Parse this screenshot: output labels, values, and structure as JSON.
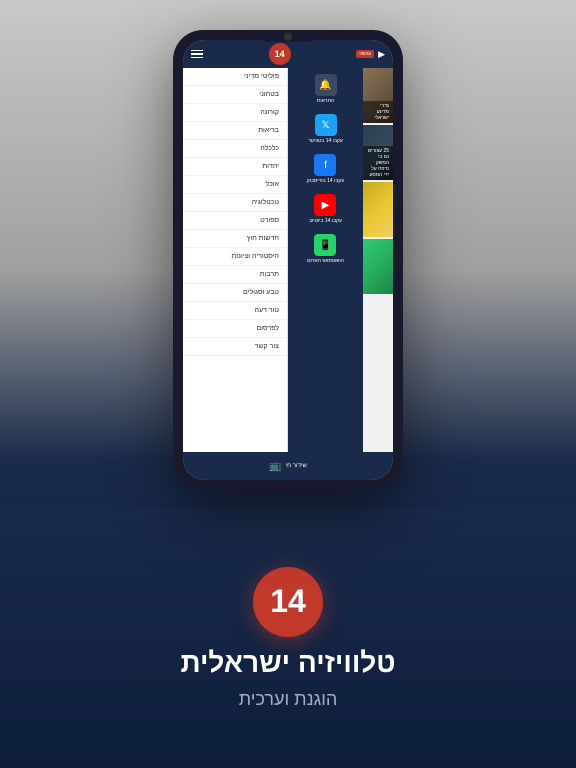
{
  "background": {
    "top_color": "#c8c8c8",
    "bottom_color": "#0d1e3a"
  },
  "phone": {
    "header": {
      "logo": "14",
      "live_label": "עכשיו"
    },
    "sidebar": {
      "items": [
        {
          "label": "פוליטי מדיני"
        },
        {
          "label": "בטחוני"
        },
        {
          "label": "קורונה"
        },
        {
          "label": "בריאות"
        },
        {
          "label": "כלכלה"
        },
        {
          "label": "יהדות"
        },
        {
          "label": "אוכל"
        },
        {
          "label": "טכנולוגיה"
        },
        {
          "label": "ספורט"
        },
        {
          "label": "חדשות חוץ"
        },
        {
          "label": "היסטוריה וציונות"
        },
        {
          "label": "תרבות"
        },
        {
          "label": "טבע וסגולים"
        },
        {
          "label": "טור דעה"
        },
        {
          "label": "לפרסום"
        },
        {
          "label": "צור קשר"
        }
      ]
    },
    "notification_panel": {
      "items": [
        {
          "icon": "bell",
          "text": "התראות"
        },
        {
          "icon": "twitter",
          "text": "עקבו 14 בטוויטר"
        },
        {
          "icon": "facebook",
          "text": "עקבו 14 בפייסבוק"
        },
        {
          "icon": "youtube",
          "text": "עקבו 14 ביוטיוב"
        },
        {
          "icon": "whatsapp",
          "text": "הוואטסאפ האדום"
        }
      ]
    },
    "news_items": [
      {
        "text": "גדרי מדינע ישראלי"
      },
      {
        "text": "25 עצורים נם בי המשק נדפח על ידי המסע"
      },
      {
        "text": ""
      },
      {
        "text": ""
      }
    ],
    "bottom_bar": {
      "icon": "live",
      "text": "שידור חי"
    }
  },
  "bottom_section": {
    "logo": "14",
    "title": "טלוויזיה ישראלית",
    "subtitle": "הוגנת וערכית"
  }
}
